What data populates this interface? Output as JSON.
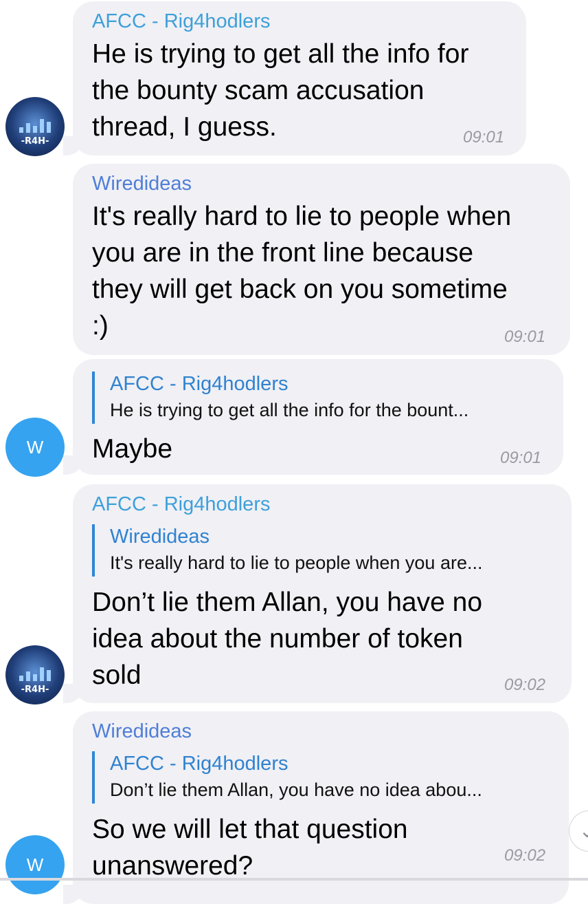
{
  "messages": [
    {
      "sender": "AFCC - Rig4hodlers",
      "lines": [
        "He is trying to get all the info for",
        "the bounty scam accusation",
        "thread, I guess."
      ],
      "time": "09:01"
    },
    {
      "sender": "Wiredideas",
      "lines": [
        "It's really hard to lie to people when",
        "you are in the front line because",
        "they will get back on you sometime",
        ":)"
      ],
      "time": "09:01"
    },
    {
      "reply": {
        "name": "AFCC - Rig4hodlers",
        "text": "He is trying to get all the info for the bount..."
      },
      "lines": [
        "Maybe"
      ],
      "time": "09:01"
    },
    {
      "sender": "AFCC - Rig4hodlers",
      "reply": {
        "name": "Wiredideas",
        "text": "It's really hard to lie to people when you are..."
      },
      "lines": [
        "Don’t lie them Allan, you have no",
        "idea about the number of token",
        "sold"
      ],
      "time": "09:02"
    },
    {
      "sender": "Wiredideas",
      "reply": {
        "name": "AFCC - Rig4hodlers",
        "text": "Don’t lie them Allan, you have no idea abou..."
      },
      "lines": [
        "So we will let that question",
        "unanswered?"
      ],
      "time": "09:02"
    }
  ],
  "avatars": {
    "afcc_badge": "-R4H-",
    "wired_initial": "W"
  },
  "icons": {
    "scroll_down": "chevron-down-icon"
  },
  "colors": {
    "bubble": "#f0f0f5",
    "afcc_name": "#3ea0d9",
    "wired_name": "#4f7ed6",
    "reply_bar": "#2e86d6",
    "avatar_w": "#35a3f0"
  }
}
